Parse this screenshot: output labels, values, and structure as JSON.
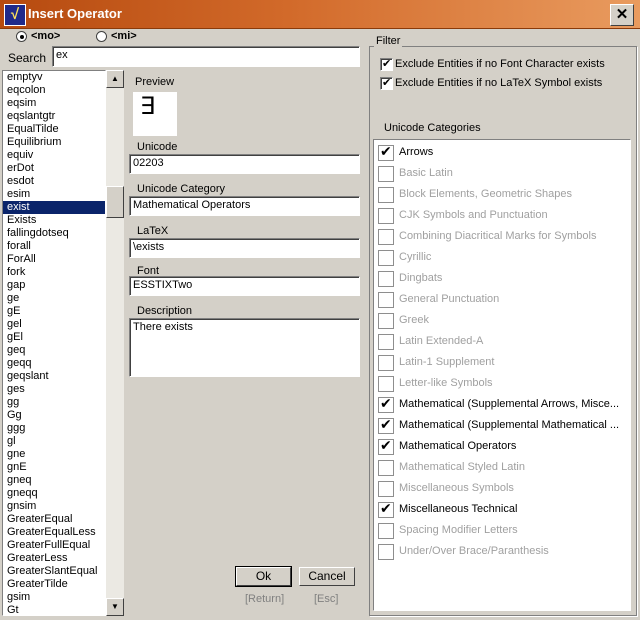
{
  "window": {
    "title": "Insert Operator",
    "icon_glyph": "√",
    "close_glyph": "✕"
  },
  "mode": {
    "options": [
      {
        "label": "<mo>",
        "selected": true
      },
      {
        "label": "<mi>",
        "selected": false
      }
    ]
  },
  "search": {
    "label": "Search",
    "value": "ex"
  },
  "entity_list": {
    "items": [
      "emptyv",
      "eqcolon",
      "eqsim",
      "eqslantgtr",
      "EqualTilde",
      "Equilibrium",
      "equiv",
      "erDot",
      "esdot",
      "esim",
      "exist",
      "Exists",
      "fallingdotseq",
      "forall",
      "ForAll",
      "fork",
      "gap",
      "ge",
      "gE",
      "gel",
      "gEl",
      "geq",
      "geqq",
      "geqslant",
      "ges",
      "gg",
      "Gg",
      "ggg",
      "gl",
      "gne",
      "gnE",
      "gneq",
      "gneqq",
      "gnsim",
      "GreaterEqual",
      "GreaterEqualLess",
      "GreaterFullEqual",
      "GreaterLess",
      "GreaterSlantEqual",
      "GreaterTilde",
      "gsim",
      "Gt"
    ],
    "selected_index": 10
  },
  "details": {
    "preview_label": "Preview",
    "preview_glyph": "∃",
    "unicode_label": "Unicode",
    "unicode_value": "02203",
    "category_label": "Unicode Category",
    "category_value": "Mathematical Operators",
    "latex_label": "LaTeX",
    "latex_value": "\\exists",
    "font_label": "Font",
    "font_value": "ESSTIXTwo",
    "description_label": "Description",
    "description_value": "There exists"
  },
  "buttons": {
    "ok_label": "Ok",
    "ok_hint": "[Return]",
    "cancel_label": "Cancel",
    "cancel_hint": "[Esc]"
  },
  "filter": {
    "title": "Filter",
    "exclude_font_label": "Exclude Entities if no Font Character exists",
    "exclude_font_checked": true,
    "exclude_latex_label": "Exclude Entities if no LaTeX Symbol exists",
    "exclude_latex_checked": true,
    "categories_label": "Unicode Categories",
    "categories": [
      {
        "label": "Arrows",
        "checked": true
      },
      {
        "label": "Basic Latin",
        "checked": false
      },
      {
        "label": "Block Elements, Geometric Shapes",
        "checked": false
      },
      {
        "label": "CJK Symbols and Punctuation",
        "checked": false
      },
      {
        "label": "Combining Diacritical Marks for Symbols",
        "checked": false
      },
      {
        "label": "Cyrillic",
        "checked": false
      },
      {
        "label": "Dingbats",
        "checked": false
      },
      {
        "label": "General Punctuation",
        "checked": false
      },
      {
        "label": "Greek",
        "checked": false
      },
      {
        "label": "Latin Extended-A",
        "checked": false
      },
      {
        "label": "Latin-1 Supplement",
        "checked": false
      },
      {
        "label": "Letter-like Symbols",
        "checked": false
      },
      {
        "label": "Mathematical (Supplemental Arrows, Misce...",
        "checked": true
      },
      {
        "label": "Mathematical (Supplemental Mathematical ...",
        "checked": true
      },
      {
        "label": "Mathematical Operators",
        "checked": true
      },
      {
        "label": "Mathematical Styled Latin",
        "checked": false
      },
      {
        "label": "Miscellaneous Symbols",
        "checked": false
      },
      {
        "label": "Miscellaneous Technical",
        "checked": true
      },
      {
        "label": "Spacing Modifier Letters",
        "checked": false
      },
      {
        "label": "Under/Over Brace/Paranthesis",
        "checked": false
      }
    ]
  }
}
